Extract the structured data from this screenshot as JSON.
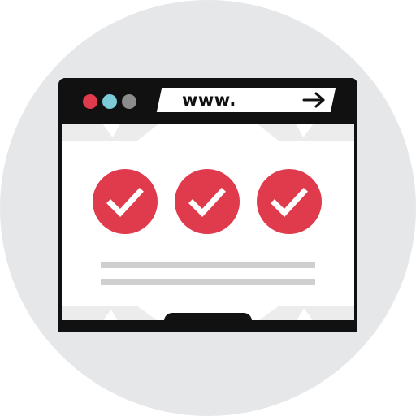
{
  "browser": {
    "address_bar": {
      "url_text": "www.",
      "go_icon": "arrow-right-icon"
    },
    "window_controls": [
      "red",
      "cyan",
      "gray"
    ]
  },
  "content": {
    "checkmarks": 3,
    "text_lines": 2
  },
  "colors": {
    "background_circle": "#e6e7e9",
    "frame": "#111111",
    "accent": "#e03a4d",
    "secondary": "#7cccd8",
    "tertiary": "#8c8c8c",
    "text_line": "#cfcfcf"
  }
}
